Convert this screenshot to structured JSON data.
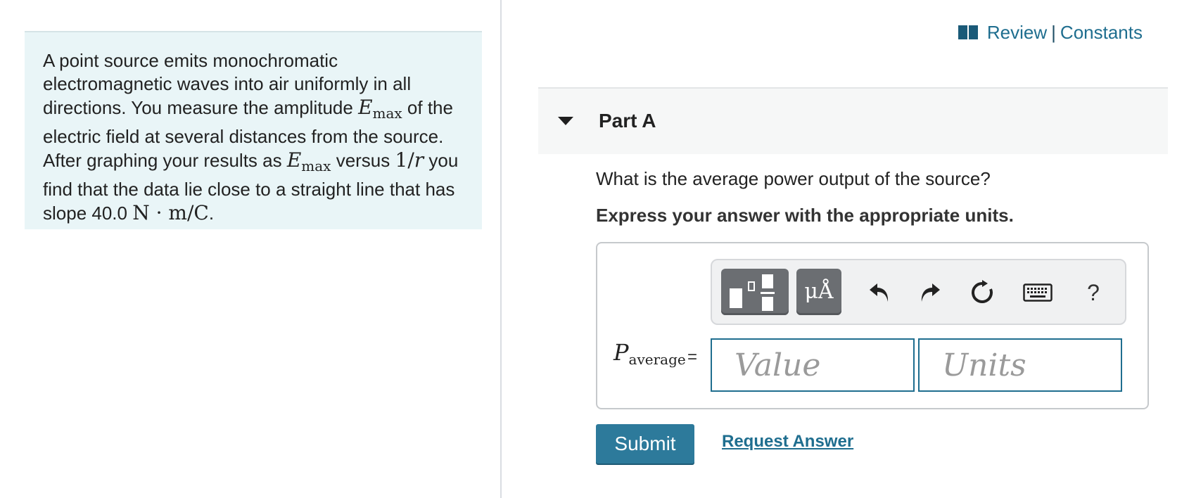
{
  "problem": {
    "text_1": "A point source emits monochromatic electromagnetic waves into air uniformly in all directions. You measure the amplitude ",
    "emax_symbol": "E",
    "emax_sub": "max",
    "text_2": " of the electric field at several distances from the source. After graphing your results as ",
    "text_3": " versus ",
    "one_over_r": "1/",
    "r_symbol": "r",
    "text_4": " you find that the data lie close to a straight line that has slope 40.0 ",
    "slope_units": "N · m/C",
    "text_5": "."
  },
  "header": {
    "review": "Review",
    "separator": "|",
    "constants": "Constants"
  },
  "part": {
    "title": "Part A",
    "question": "What is the average power output of the source?",
    "instruction": "Express your answer with the appropriate units."
  },
  "toolbar": {
    "units_label": "μÅ",
    "help_label": "?"
  },
  "answer": {
    "symbol": "P",
    "symbol_sub": "average",
    "equals": "=",
    "value": "",
    "value_placeholder": "Value",
    "units": "",
    "units_placeholder": "Units"
  },
  "actions": {
    "submit": "Submit",
    "request_answer": "Request Answer"
  },
  "colors": {
    "accent": "#1f6e8f",
    "submit_bg": "#2d7a9b",
    "problem_bg": "#e9f5f7"
  }
}
